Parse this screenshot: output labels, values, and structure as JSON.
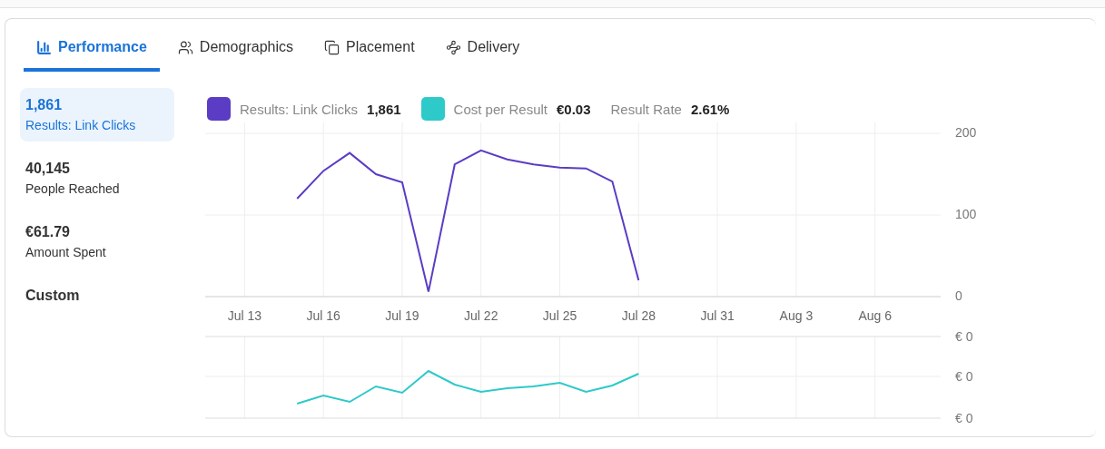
{
  "tabs": [
    {
      "label": "Performance",
      "selected": true
    },
    {
      "label": "Demographics",
      "selected": false
    },
    {
      "label": "Placement",
      "selected": false
    },
    {
      "label": "Delivery",
      "selected": false
    }
  ],
  "sidebar": {
    "items": [
      {
        "kind": "metric",
        "value": "1,861",
        "label": "Results: Link Clicks",
        "selected": true
      },
      {
        "kind": "metric",
        "value": "40,145",
        "label": "People Reached",
        "selected": false
      },
      {
        "kind": "metric",
        "value": "€61.79",
        "label": "Amount Spent",
        "selected": false
      },
      {
        "kind": "custom",
        "label": "Custom"
      }
    ]
  },
  "legend": [
    {
      "kind": "swatch",
      "label": "Results: Link Clicks",
      "value": "1,861",
      "color": "#5b3cc4"
    },
    {
      "kind": "swatch",
      "label": "Cost per Result",
      "value": "€0.03",
      "color": "#2ec9c9"
    },
    {
      "kind": "plain",
      "label": "Result Rate",
      "value": "2.61%"
    }
  ],
  "chart_data": {
    "type": "line",
    "categories": [
      null,
      "Jul 13",
      null,
      null,
      "Jul 16",
      null,
      null,
      "Jul 19",
      null,
      null,
      "Jul 22",
      null,
      null,
      "Jul 25",
      null,
      null,
      "Jul 28",
      null,
      null,
      "Jul 31",
      null,
      null,
      "Aug 3",
      null,
      null,
      "Aug 6",
      null,
      null
    ],
    "series": [
      {
        "color": "#5b3cc4",
        "values": [
          null,
          null,
          null,
          120,
          154,
          176,
          150,
          140,
          6,
          162,
          179,
          168,
          162,
          158,
          157,
          141,
          20,
          null,
          null,
          null,
          null,
          null,
          null,
          null,
          null,
          null,
          null,
          null
        ]
      }
    ],
    "ylim": [
      0,
      200
    ],
    "yticks": [
      0,
      100,
      200
    ],
    "grid": true
  },
  "cost_chart": {
    "ticks": [
      "€ 0",
      "€ 0",
      "€ 0"
    ],
    "color": "#2ec9c9"
  }
}
